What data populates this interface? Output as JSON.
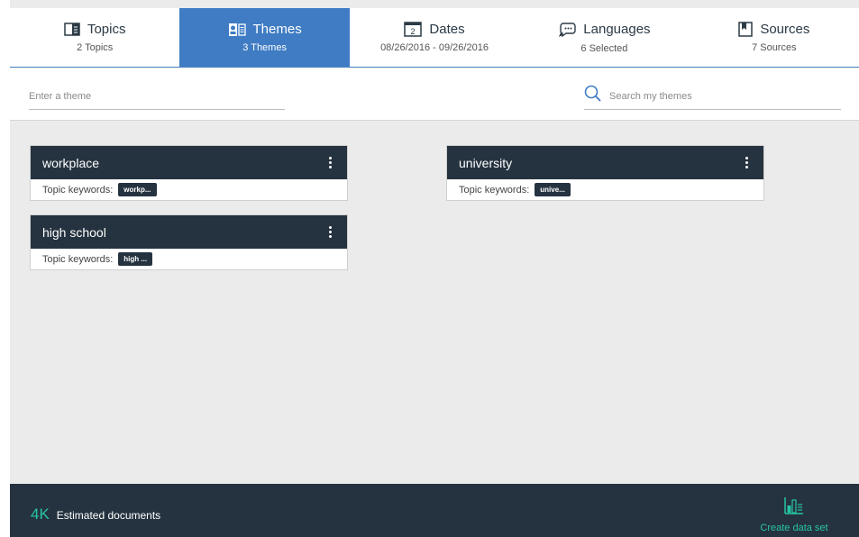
{
  "tabs": [
    {
      "title": "Topics",
      "subtitle": "2 Topics",
      "icon": "book-icon",
      "active": false
    },
    {
      "title": "Themes",
      "subtitle": "3 Themes",
      "icon": "themes-icon",
      "active": true
    },
    {
      "title": "Dates",
      "subtitle": "08/26/2016 - 09/26/2016",
      "icon": "calendar-icon",
      "calendar_day": "2",
      "active": false
    },
    {
      "title": "Languages",
      "subtitle": "6 Selected",
      "icon": "speech-bubble-icon",
      "active": false
    },
    {
      "title": "Sources",
      "subtitle": "7 Sources",
      "icon": "source-doc-icon",
      "active": false
    }
  ],
  "theme_input": {
    "placeholder": "Enter a theme",
    "value": ""
  },
  "search": {
    "placeholder": "Search my themes",
    "value": ""
  },
  "themes": [
    {
      "title": "workplace",
      "keywords_label": "Topic keywords:",
      "keyword": "workp..."
    },
    {
      "title": "university",
      "keywords_label": "Topic keywords:",
      "keyword": "unive..."
    },
    {
      "title": "high school",
      "keywords_label": "Topic keywords:",
      "keyword": "high ..."
    }
  ],
  "footer": {
    "estimate_value": "4K",
    "estimate_label": "Estimated documents",
    "create_label": "Create data set"
  },
  "colors": {
    "active_tab": "#3f7cc3",
    "dark_navy": "#253340",
    "accent_teal": "#27c4a4",
    "background": "#ebebeb"
  }
}
